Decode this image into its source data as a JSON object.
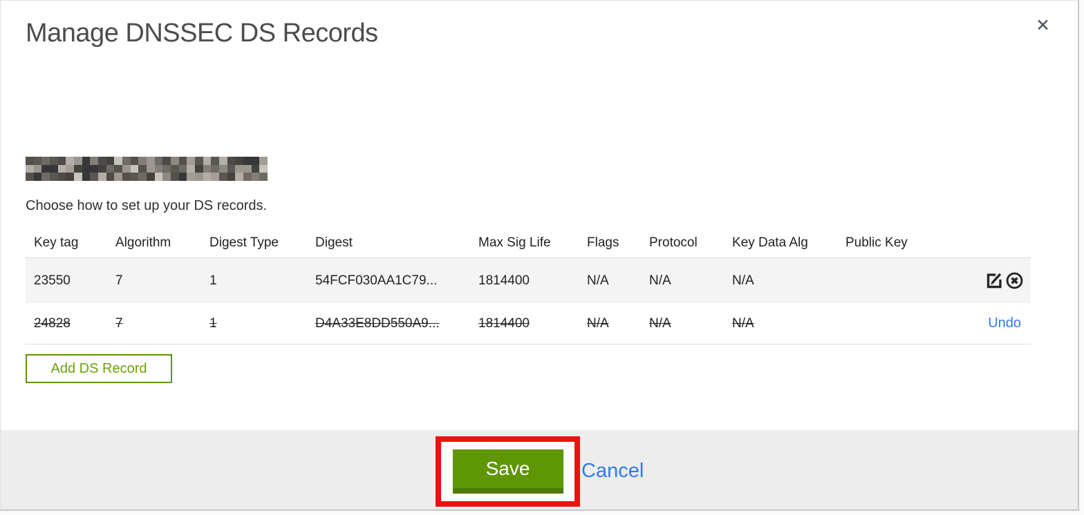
{
  "dialog": {
    "title": "Manage DNSSEC DS Records",
    "close_glyph": "✕",
    "intro": "Choose how to set up your DS records.",
    "domain_redacted": true
  },
  "table": {
    "columns": [
      "Key tag",
      "Algorithm",
      "Digest Type",
      "Digest",
      "Max Sig Life",
      "Flags",
      "Protocol",
      "Key Data Alg",
      "Public Key"
    ],
    "rows": [
      {
        "key_tag": "23550",
        "algorithm": "7",
        "digest_type": "1",
        "digest": "54FCF030AA1C79...",
        "max_sig_life": "1814400",
        "flags": "N/A",
        "protocol": "N/A",
        "key_data_alg": "N/A",
        "public_key": "",
        "state": "active"
      },
      {
        "key_tag": "24828",
        "algorithm": "7",
        "digest_type": "1",
        "digest": "D4A33E8DD550A9...",
        "max_sig_life": "1814400",
        "flags": "N/A",
        "protocol": "N/A",
        "key_data_alg": "N/A",
        "public_key": "",
        "state": "deleted",
        "undo_label": "Undo"
      }
    ],
    "add_button_label": "Add DS Record"
  },
  "footer": {
    "save_label": "Save",
    "cancel_label": "Cancel"
  },
  "colors": {
    "button_green": "#5e9604",
    "button_green_shadow": "#4d7c04",
    "outline_button_green": "#5e9403",
    "annotation_red": "#ee1010",
    "link_blue": "#2d7af0",
    "row_alt_background": "#f4f4f4",
    "footer_background": "#ededed"
  },
  "redaction": {
    "palette": [
      "#45423e",
      "#5a5652",
      "#6e6a64",
      "#837f78",
      "#9b968e",
      "#b3aea6",
      "#c7c2ba",
      "#37373b",
      "#55504a",
      "#8d8880",
      "#a49e96",
      "#4e4a4a"
    ]
  }
}
